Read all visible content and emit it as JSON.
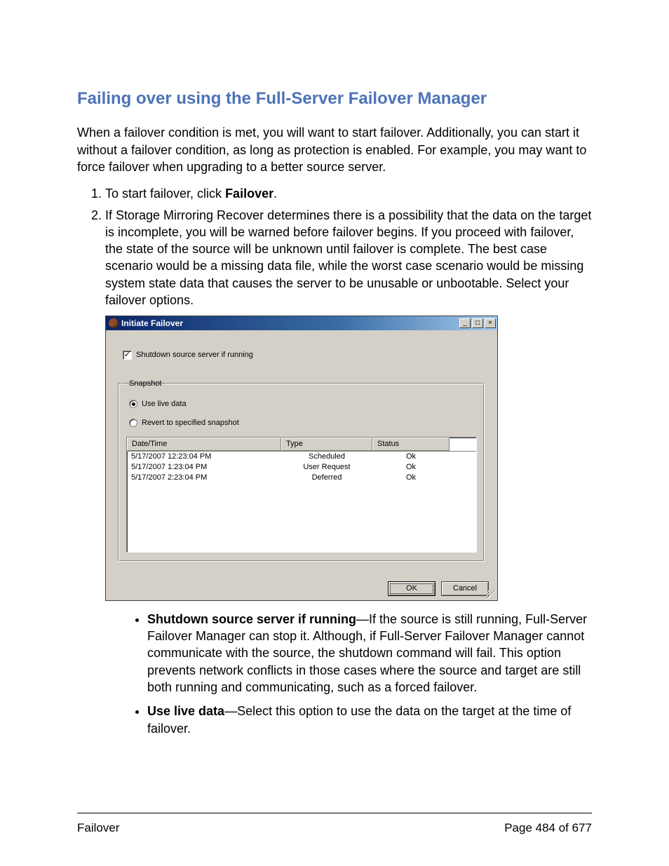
{
  "heading": "Failing over using the Full-Server Failover Manager",
  "intro": "When a failover condition is met, you will want to start failover. Additionally, you can start it without a failover condition, as long as protection is enabled. For example, you may want to force failover when upgrading to a better source server.",
  "steps": {
    "s1_pre": "To start failover, click ",
    "s1_bold": "Failover",
    "s1_post": ".",
    "s2": "If Storage Mirroring Recover determines there is a possibility that the data on the target is incomplete, you will be warned before failover begins. If you proceed with failover, the state of the source will be unknown until failover is complete. The best case scenario would be a missing data file, while the worst case scenario would be missing system state data that causes the server to be unusable or unbootable. Select your failover options."
  },
  "dialog": {
    "title": "Initiate Failover",
    "winbtns": {
      "min": "_",
      "max": "□",
      "close": "×"
    },
    "checkbox_label": "Shutdown source server if running",
    "checkbox_checked": "✓",
    "snapshot_legend": "Snapshot",
    "radio1_label": "Use live data",
    "radio2_label": "Revert to specified snapshot",
    "cols": {
      "c1": "Date/Time",
      "c2": "Type",
      "c3": "Status"
    },
    "rows": [
      {
        "dt": "5/17/2007 12:23:04 PM",
        "type": "Scheduled",
        "status": "Ok"
      },
      {
        "dt": "5/17/2007 1:23:04 PM",
        "type": "User Request",
        "status": "Ok"
      },
      {
        "dt": "5/17/2007 2:23:04 PM",
        "type": "Deferred",
        "status": "Ok"
      }
    ],
    "ok": "OK",
    "cancel": "Cancel"
  },
  "bullets": {
    "b1_bold": "Shutdown source server if running",
    "b1_text": "—If the source is still running, Full-Server Failover Manager can stop it. Although, if Full-Server Failover Manager cannot communicate with the source, the shutdown command will fail. This option prevents network conflicts in those cases where the source and target are still both running and communicating, such as a forced failover.",
    "b2_bold": "Use live data",
    "b2_text": "—Select this option to use the data on the target at the time of failover."
  },
  "footer": {
    "left": "Failover",
    "right": "Page 484 of 677"
  }
}
